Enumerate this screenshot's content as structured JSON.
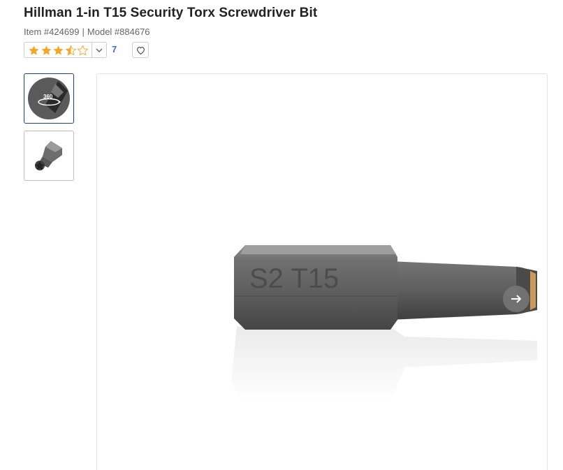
{
  "product": {
    "title": "Hillman 1-in T15 Security Torx Screwdriver Bit",
    "item_label": "Item #424699",
    "separator": "|",
    "model_label": "Model #884676"
  },
  "rating": {
    "stars": 3.5,
    "max_stars": 5,
    "review_count": "7",
    "star_color": "#f5a623"
  },
  "thumbnails": [
    {
      "badge": "360",
      "icon": "360-spin-icon",
      "selected": true
    },
    {
      "icon": "torx-bit-thumbnail",
      "selected": false
    }
  ],
  "main_image": {
    "engraving": "S2 T15",
    "icon": "torx-bit-product-photo"
  },
  "icons": {
    "dropdown": "chevron-down-icon",
    "favorite": "heart-icon",
    "next": "arrow-right-icon"
  },
  "colors": {
    "link": "#3b6bd6",
    "selected_border": "#1c3f8f"
  }
}
